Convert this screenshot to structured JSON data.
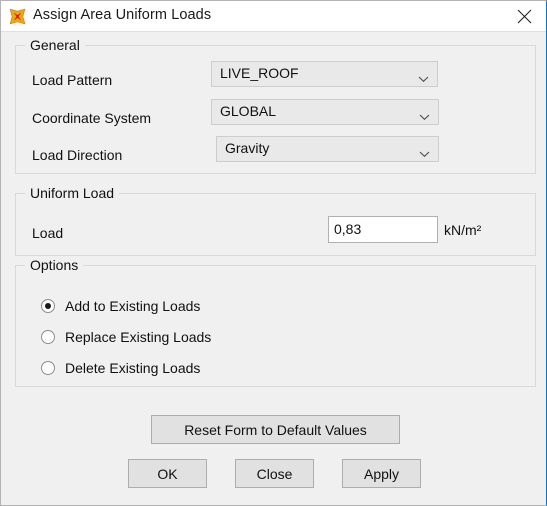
{
  "window": {
    "title": "Assign Area Uniform Loads",
    "icon": "app-logo-icon",
    "close_icon": "close-icon"
  },
  "general": {
    "group_title": "General",
    "fields": [
      {
        "label": "Load Pattern",
        "value": "LIVE_ROOF",
        "icon": "chevron-down-icon"
      },
      {
        "label": "Coordinate System",
        "value": "GLOBAL",
        "icon": "chevron-down-icon"
      },
      {
        "label": "Load Direction",
        "value": "Gravity",
        "icon": "chevron-down-icon"
      }
    ]
  },
  "uniform_load": {
    "group_title": "Uniform Load",
    "label": "Load",
    "value": "0,83",
    "placeholder": "",
    "unit": "kN/m²"
  },
  "options": {
    "group_title": "Options",
    "items": [
      {
        "label": "Add to Existing Loads",
        "selected": true
      },
      {
        "label": "Replace Existing Loads",
        "selected": false
      },
      {
        "label": "Delete Existing Loads",
        "selected": false
      }
    ]
  },
  "buttons": {
    "reset": "Reset Form to Default Values",
    "ok": "OK",
    "close": "Close",
    "apply": "Apply"
  },
  "colors": {
    "dialog_background": "#f0f0f0",
    "titlebar_background": "#ffffff",
    "accent_border": "#0078d7",
    "button_face": "#e1e1e1",
    "combo_face": "#e9e9e9",
    "input_background": "#ffffff",
    "text": "#111111",
    "icon_red": "#d32020",
    "icon_orange": "#f0a818"
  }
}
